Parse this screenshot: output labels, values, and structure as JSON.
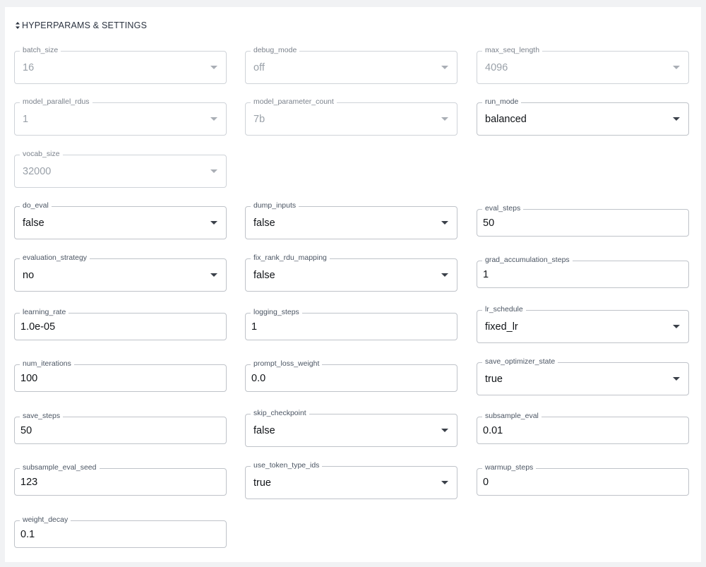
{
  "section": {
    "title": "HYPERPARAMS & SETTINGS"
  },
  "fields": {
    "batch_size": {
      "label": "batch_size",
      "value": "16"
    },
    "debug_mode": {
      "label": "debug_mode",
      "value": "off"
    },
    "max_seq_length": {
      "label": "max_seq_length",
      "value": "4096"
    },
    "model_parallel_rdus": {
      "label": "model_parallel_rdus",
      "value": "1"
    },
    "model_parameter_count": {
      "label": "model_parameter_count",
      "value": "7b"
    },
    "run_mode": {
      "label": "run_mode",
      "value": "balanced"
    },
    "vocab_size": {
      "label": "vocab_size",
      "value": "32000"
    },
    "do_eval": {
      "label": "do_eval",
      "value": "false"
    },
    "dump_inputs": {
      "label": "dump_inputs",
      "value": "false"
    },
    "eval_steps": {
      "label": "eval_steps",
      "value": "50"
    },
    "evaluation_strategy": {
      "label": "evaluation_strategy",
      "value": "no"
    },
    "fix_rank_rdu_mapping": {
      "label": "fix_rank_rdu_mapping",
      "value": "false"
    },
    "grad_accumulation_steps": {
      "label": "grad_accumulation_steps",
      "value": "1"
    },
    "learning_rate": {
      "label": "learning_rate",
      "value": "1.0e-05"
    },
    "logging_steps": {
      "label": "logging_steps",
      "value": "1"
    },
    "lr_schedule": {
      "label": "lr_schedule",
      "value": "fixed_lr"
    },
    "num_iterations": {
      "label": "num_iterations",
      "value": "100"
    },
    "prompt_loss_weight": {
      "label": "prompt_loss_weight",
      "value": "0.0"
    },
    "save_optimizer_state": {
      "label": "save_optimizer_state",
      "value": "true"
    },
    "save_steps": {
      "label": "save_steps",
      "value": "50"
    },
    "skip_checkpoint": {
      "label": "skip_checkpoint",
      "value": "false"
    },
    "subsample_eval": {
      "label": "subsample_eval",
      "value": "0.01"
    },
    "subsample_eval_seed": {
      "label": "subsample_eval_seed",
      "value": "123"
    },
    "use_token_type_ids": {
      "label": "use_token_type_ids",
      "value": "true"
    },
    "warmup_steps": {
      "label": "warmup_steps",
      "value": "0"
    },
    "weight_decay": {
      "label": "weight_decay",
      "value": "0.1"
    }
  },
  "icons": {
    "section_toggle": "sort-arrows-icon",
    "dropdown": "chevron-down-icon"
  },
  "colors": {
    "border": "#bfc3c9",
    "disabled_text": "#9aa1a9",
    "text": "#111418",
    "background": "#f1f2f4"
  }
}
